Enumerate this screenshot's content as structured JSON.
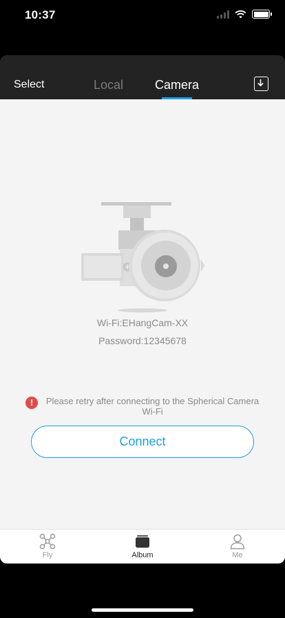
{
  "status_bar": {
    "time": "10:37"
  },
  "header": {
    "select_label": "Select",
    "tabs": [
      {
        "label": "Local",
        "active": false
      },
      {
        "label": "Camera",
        "active": true
      }
    ],
    "accent_color": "#1e9ee0"
  },
  "main": {
    "wifi_name": "Wi-Fi:EHangCam-XX",
    "wifi_password": "Password:12345678",
    "alert_text": "Please retry after connecting to the Spherical Camera Wi-Fi",
    "connect_label": "Connect"
  },
  "tabbar": {
    "items": [
      {
        "label": "Fly",
        "icon": "drone-icon",
        "active": false
      },
      {
        "label": "Album",
        "icon": "album-icon",
        "active": true
      },
      {
        "label": "Me",
        "icon": "person-icon",
        "active": false
      }
    ]
  }
}
